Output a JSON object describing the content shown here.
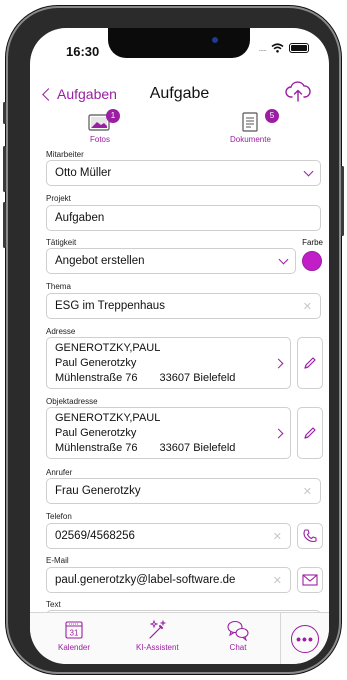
{
  "status": {
    "time": "16:30"
  },
  "nav": {
    "back_label": "Aufgaben",
    "title": "Aufgabe"
  },
  "attachments": {
    "fotos": {
      "label": "Fotos",
      "count": "1"
    },
    "dokumente": {
      "label": "Dokumente",
      "count": "5"
    }
  },
  "form": {
    "mitarbeiter": {
      "label": "Mitarbeiter",
      "value": "Otto Müller"
    },
    "projekt": {
      "label": "Projekt",
      "value": "Aufgaben"
    },
    "taetigkeit": {
      "label": "Tätigkeit",
      "value": "Angebot erstellen"
    },
    "farbe": {
      "label": "Farbe",
      "color": "#c21ec8"
    },
    "thema": {
      "label": "Thema",
      "value": "ESG im Treppenhaus"
    },
    "adresse": {
      "label": "Adresse",
      "line1": "GENEROTZKY,PAUL",
      "line2": "Paul Generotzky",
      "street": "Mühlenstraße 76",
      "city": "33607 Bielefeld"
    },
    "objektadresse": {
      "label": "Objektadresse",
      "line1": "GENEROTZKY,PAUL",
      "line2": "Paul Generotzky",
      "street": "Mühlenstraße 76",
      "city": "33607 Bielefeld"
    },
    "anrufer": {
      "label": "Anrufer",
      "value": "Frau Generotzky"
    },
    "telefon": {
      "label": "Telefon",
      "value": "02569/4568256"
    },
    "email": {
      "label": "E-Mail",
      "value": "paul.generotzky@label-software.de"
    },
    "text": {
      "label": "Text"
    }
  },
  "tabbar": {
    "kalender": {
      "label": "Kalender",
      "day": "31"
    },
    "ki": {
      "label": "KI-Assistent"
    },
    "chat": {
      "label": "Chat"
    },
    "more": {
      "label": "•••"
    }
  },
  "colors": {
    "accent": "#9b1ea3"
  }
}
